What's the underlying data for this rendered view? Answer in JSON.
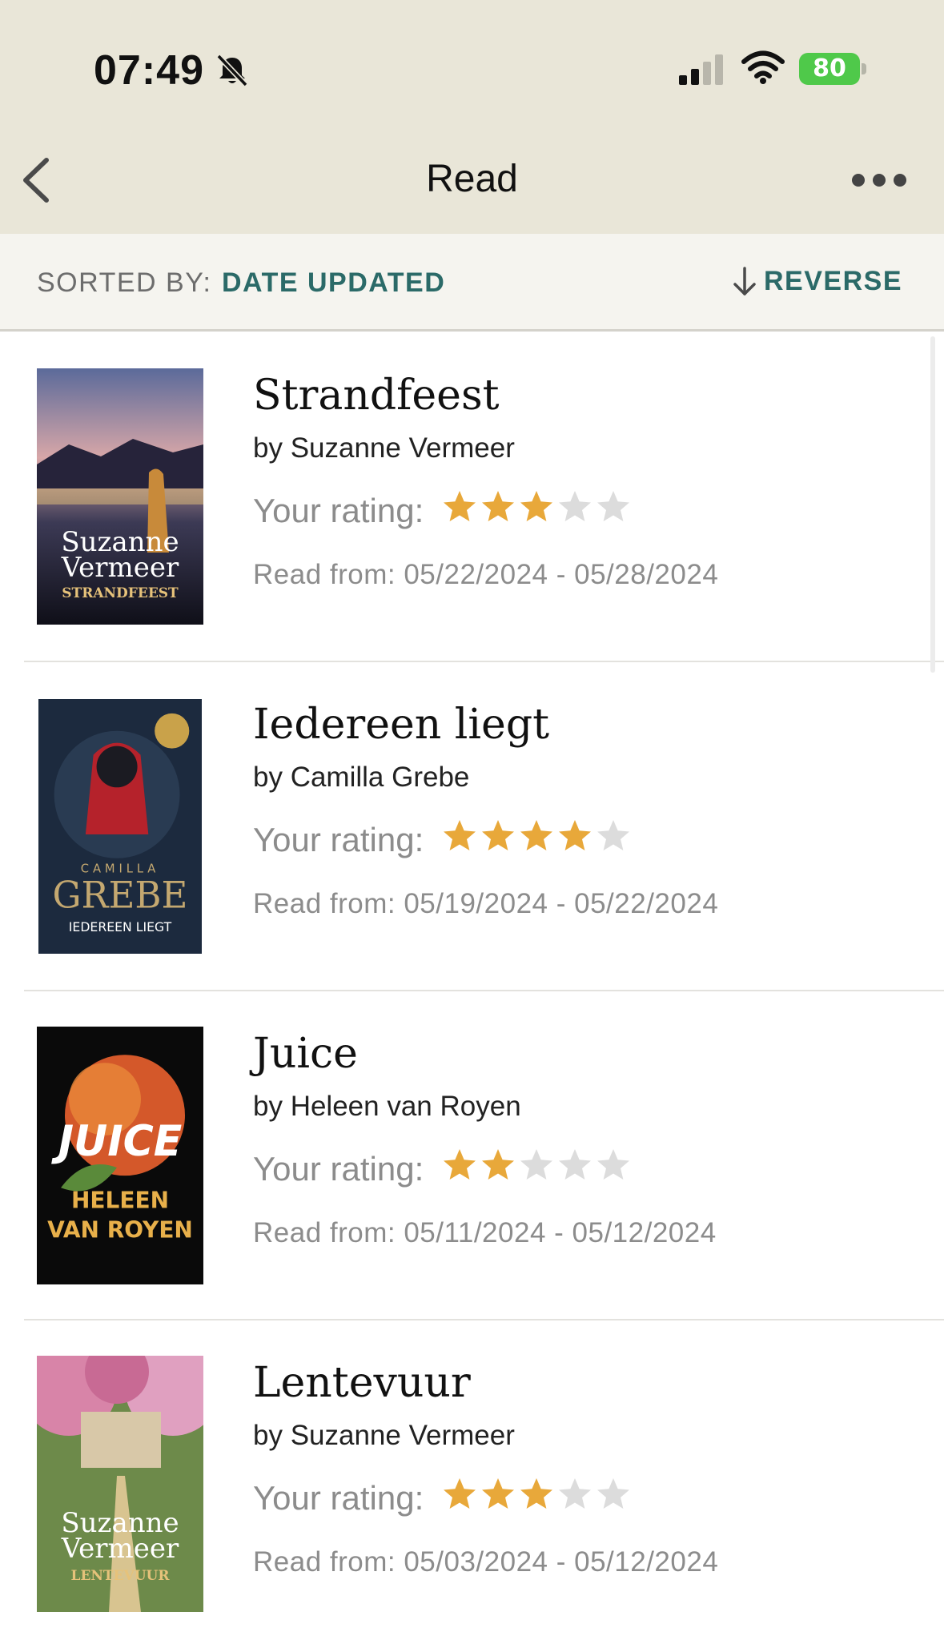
{
  "status_bar": {
    "time": "07:49",
    "battery": "80"
  },
  "nav": {
    "title": "Read"
  },
  "sort": {
    "label": "SORTED BY:",
    "value": "DATE UPDATED",
    "reverse_label": "REVERSE"
  },
  "books": [
    {
      "title": "Strandfeest",
      "author": "by Suzanne Vermeer",
      "rating_label": "Your rating:",
      "rating": 3,
      "read_dates": "Read from: 05/22/2024 - 05/28/2024",
      "cover": {
        "line1": "Suzanne",
        "line2": "Vermeer",
        "line3": "STRANDFEEST"
      }
    },
    {
      "title": "Iedereen liegt",
      "author": "by Camilla Grebe",
      "rating_label": "Your rating:",
      "rating": 4,
      "read_dates": "Read from: 05/19/2024 - 05/22/2024",
      "cover": {
        "line1": "CAMILLA",
        "line2": "GREBE",
        "line3": "IEDEREEN LIEGT"
      }
    },
    {
      "title": "Juice",
      "author": "by Heleen van Royen",
      "rating_label": "Your rating:",
      "rating": 2,
      "read_dates": "Read from: 05/11/2024 - 05/12/2024",
      "cover": {
        "line1": "JUICE",
        "line2": "HELEEN",
        "line3": "VAN ROYEN"
      }
    },
    {
      "title": "Lentevuur",
      "author": "by Suzanne Vermeer",
      "rating_label": "Your rating:",
      "rating": 3,
      "read_dates": "Read from: 05/03/2024 - 05/12/2024",
      "cover": {
        "line1": "Suzanne",
        "line2": "Vermeer",
        "line3": "LENTEVUUR"
      }
    }
  ],
  "colors": {
    "star_filled": "#e8a83a",
    "star_empty": "#dcdcdc",
    "accent": "#2b6a68",
    "topbar": "#e9e6d8"
  }
}
